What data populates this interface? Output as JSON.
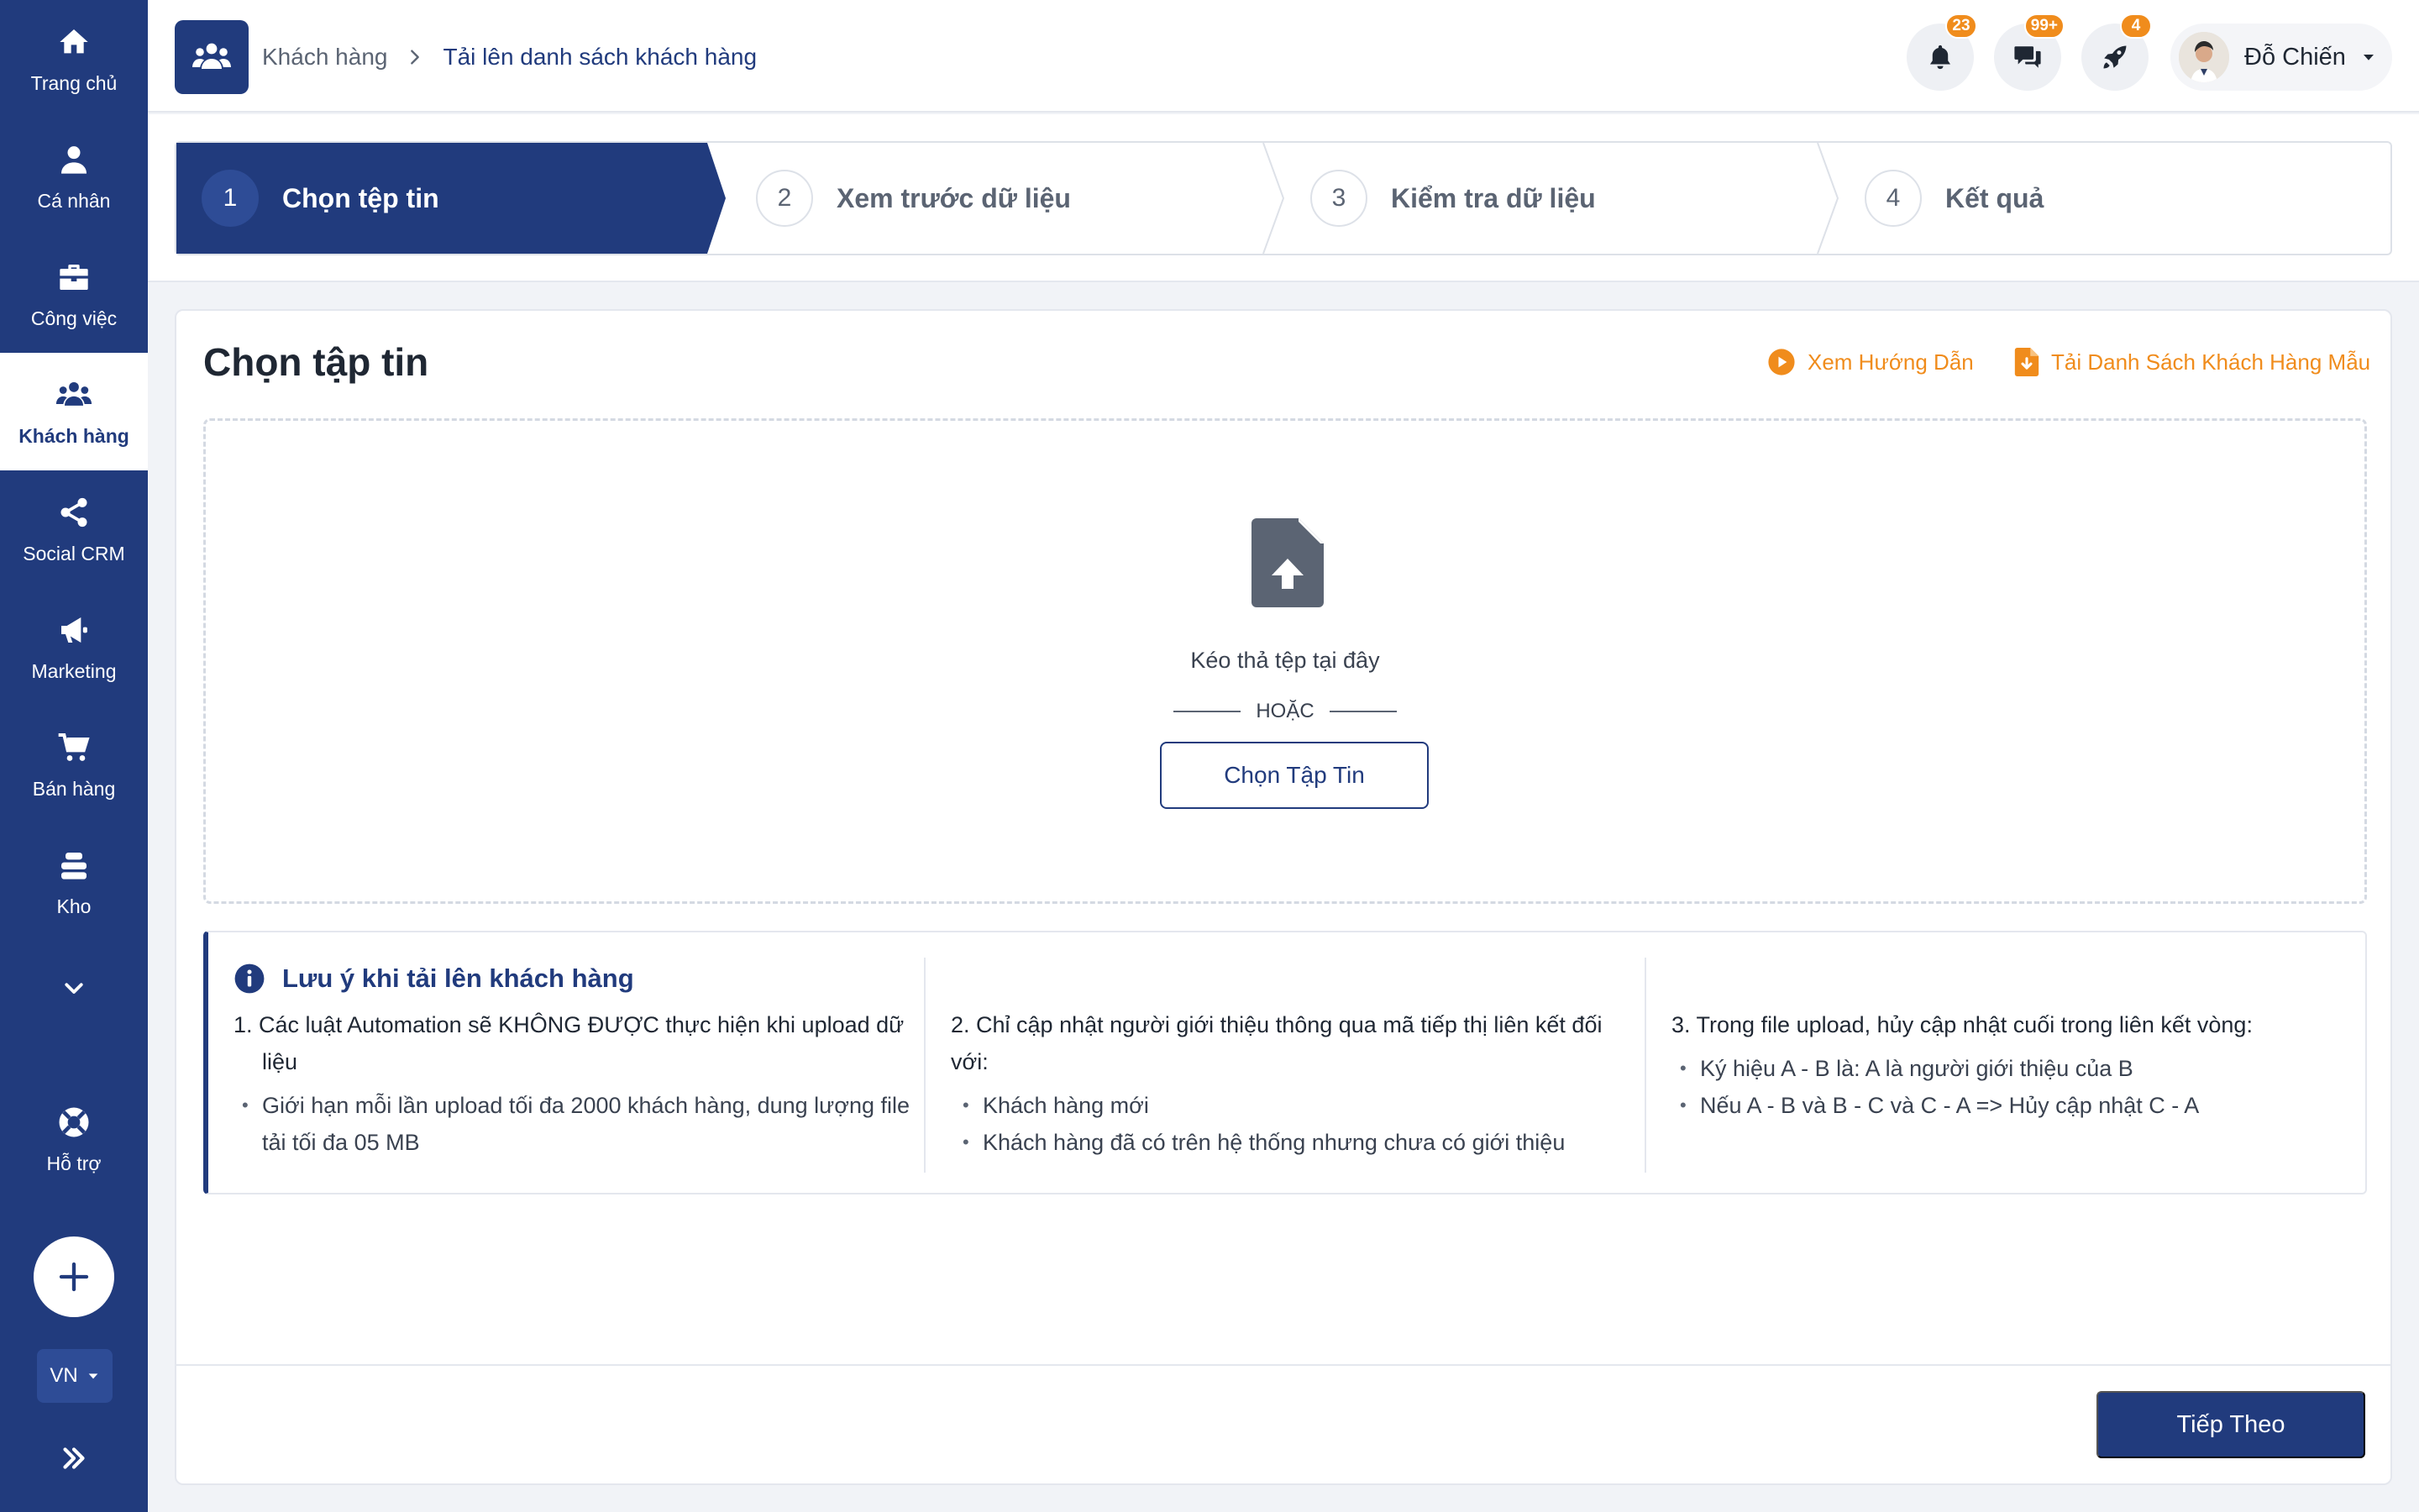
{
  "sidebar": {
    "items": [
      {
        "label": "Trang chủ",
        "icon": "home-icon"
      },
      {
        "label": "Cá nhân",
        "icon": "user-icon"
      },
      {
        "label": "Công việc",
        "icon": "briefcase-icon"
      },
      {
        "label": "Khách hàng",
        "icon": "customers-icon",
        "active": true
      },
      {
        "label": "Social CRM",
        "icon": "share-icon"
      },
      {
        "label": "Marketing",
        "icon": "megaphone-icon"
      },
      {
        "label": "Bán hàng",
        "icon": "cart-icon"
      },
      {
        "label": "Kho",
        "icon": "warehouse-icon"
      }
    ],
    "support_label": "Hỗ trợ",
    "language": "VN"
  },
  "header": {
    "breadcrumb": [
      "Khách hàng",
      "Tải lên danh sách khách hàng"
    ],
    "notifications_badge": "23",
    "messages_badge": "99+",
    "updates_badge": "4",
    "user_name": "Đỗ Chiến"
  },
  "stepper": {
    "steps": [
      {
        "number": "1",
        "label": "Chọn tệp tin",
        "active": true
      },
      {
        "number": "2",
        "label": "Xem trước dữ liệu"
      },
      {
        "number": "3",
        "label": "Kiểm tra dữ liệu"
      },
      {
        "number": "4",
        "label": "Kết quả"
      }
    ]
  },
  "main": {
    "title": "Chọn tập tin",
    "guide_link": "Xem Hướng Dẫn",
    "template_link": "Tải Danh Sách Khách Hàng Mẫu",
    "dropzone": {
      "text": "Kéo thả tệp tại đây",
      "or": "HOẶC",
      "button": "Chọn Tập Tin"
    },
    "notes": {
      "title": "Lưu ý khi tải lên khách hàng",
      "columns": [
        {
          "heading": "1. Các luật Automation sẽ KHÔNG ĐƯỢC thực hiện khi upload dữ liệu",
          "bullets": [
            "Giới hạn mỗi lần upload tối đa 2000 khách hàng, dung lượng file tải tối đa 05 MB"
          ]
        },
        {
          "heading": "2. Chỉ cập nhật người giới thiệu thông qua mã tiếp thị liên kết đối với:",
          "bullets": [
            "Khách hàng mới",
            "Khách hàng đã có trên hệ thống nhưng chưa có giới thiệu"
          ]
        },
        {
          "heading": "3. Trong file upload, hủy cập nhật cuối trong liên kết vòng:",
          "bullets": [
            "Ký hiệu A - B là: A là người giới thiệu của B",
            "Nếu A - B và B - C và C - A => Hủy cập nhật C - A"
          ]
        }
      ]
    },
    "next_button": "Tiếp Theo"
  },
  "colors": {
    "primary": "#213b7d",
    "accent": "#f08c1c",
    "background": "#f1f3f7"
  }
}
